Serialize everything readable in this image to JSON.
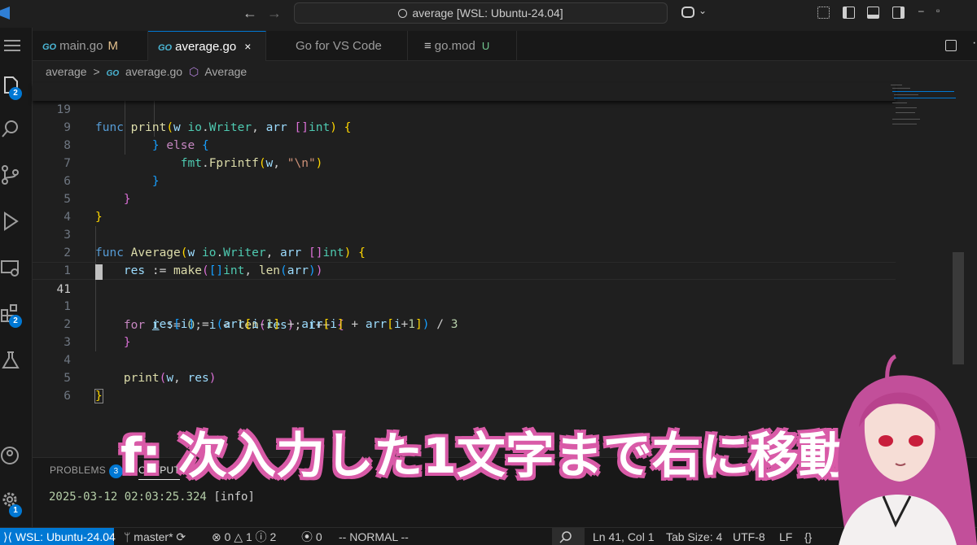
{
  "window": {
    "search_text": "average [WSL: Ubuntu-24.04]",
    "back_label": "←",
    "forward_label": "→",
    "minimize_label": "–",
    "restore_label": "▫"
  },
  "activity": {
    "explorer_badge": "2",
    "extensions_badge": "2",
    "manage_badge": "1"
  },
  "tabs": [
    {
      "icon": "GO",
      "label": "main.go",
      "status": "M"
    },
    {
      "icon": "GO",
      "label": "average.go",
      "close": "×"
    },
    {
      "label": "Go for VS Code"
    },
    {
      "icon": "≡",
      "label": "go.mod",
      "status": "U"
    }
  ],
  "breadcrumb": {
    "folder": "average",
    "sep": ">",
    "file_icon": "GO",
    "file": "average.go",
    "symbol": "Average"
  },
  "editor": {
    "lines": [
      {
        "n": "19",
        "text": "func print(w io.Writer, arr []int) {"
      },
      {
        "n": "9",
        "text": "        } else {"
      },
      {
        "n": "8",
        "text": "            fmt.Fprintf(w, \"\\n\")"
      },
      {
        "n": "7",
        "text": "        }"
      },
      {
        "n": "6",
        "text": "    }"
      },
      {
        "n": "5",
        "text": "}"
      },
      {
        "n": "4",
        "text": ""
      },
      {
        "n": "3",
        "text": "func Average(w io.Writer, arr []int) {"
      },
      {
        "n": "2",
        "text": "    res := make([]int, len(arr))"
      },
      {
        "n": "1",
        "text": ""
      },
      {
        "n": "41",
        "text": "    for i := 0; i < len(res); i++ {"
      },
      {
        "n": "1",
        "text": "        res[i] = (arr[i-1] + arr[i] + arr[i+1]) / 3"
      },
      {
        "n": "2",
        "text": "    }"
      },
      {
        "n": "3",
        "text": ""
      },
      {
        "n": "4",
        "text": "    print(w, res)"
      },
      {
        "n": "5",
        "text": "}"
      },
      {
        "n": "6",
        "text": ""
      }
    ]
  },
  "panel": {
    "tab_problems": "PROBLEMS",
    "problems_count": "3",
    "tab_output": "OUTPUT",
    "log_timestamp": "2025-03-12 02:03:25.324",
    "log_level": "[info]"
  },
  "status": {
    "remote": "WSL: Ubuntu-24.04",
    "branch": "master*",
    "errors": "0",
    "warnings": "1",
    "info": "2",
    "ports": "0",
    "mode": "-- NORMAL --",
    "position": "Ln 41, Col 1",
    "tab_size": "Tab Size: 4",
    "encoding": "UTF-8",
    "eol": "LF",
    "language": "{}"
  },
  "caption": {
    "text": "f: 次入力した1文字まで右に移動"
  },
  "colors": {
    "accent": "#0078d4",
    "caption_outline": "#d95ca8",
    "avatar_hair": "#c24f9a"
  }
}
